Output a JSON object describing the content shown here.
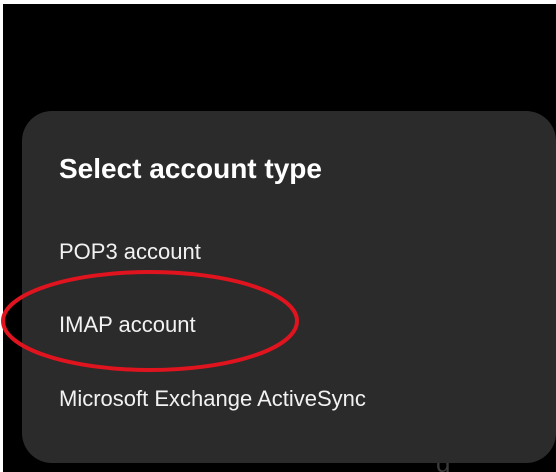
{
  "dialog": {
    "title": "Select account type",
    "options": [
      {
        "label": "POP3 account"
      },
      {
        "label": "IMAP account"
      },
      {
        "label": "Microsoft Exchange ActiveSync"
      }
    ]
  },
  "background": {
    "partial_text": "g"
  },
  "annotation": {
    "type": "ellipse",
    "color": "#e0141e",
    "highlighted_option": "IMAP account"
  },
  "colors": {
    "dialog_background": "#2b2b2b",
    "screen_background": "#000000",
    "text": "#ffffff"
  }
}
